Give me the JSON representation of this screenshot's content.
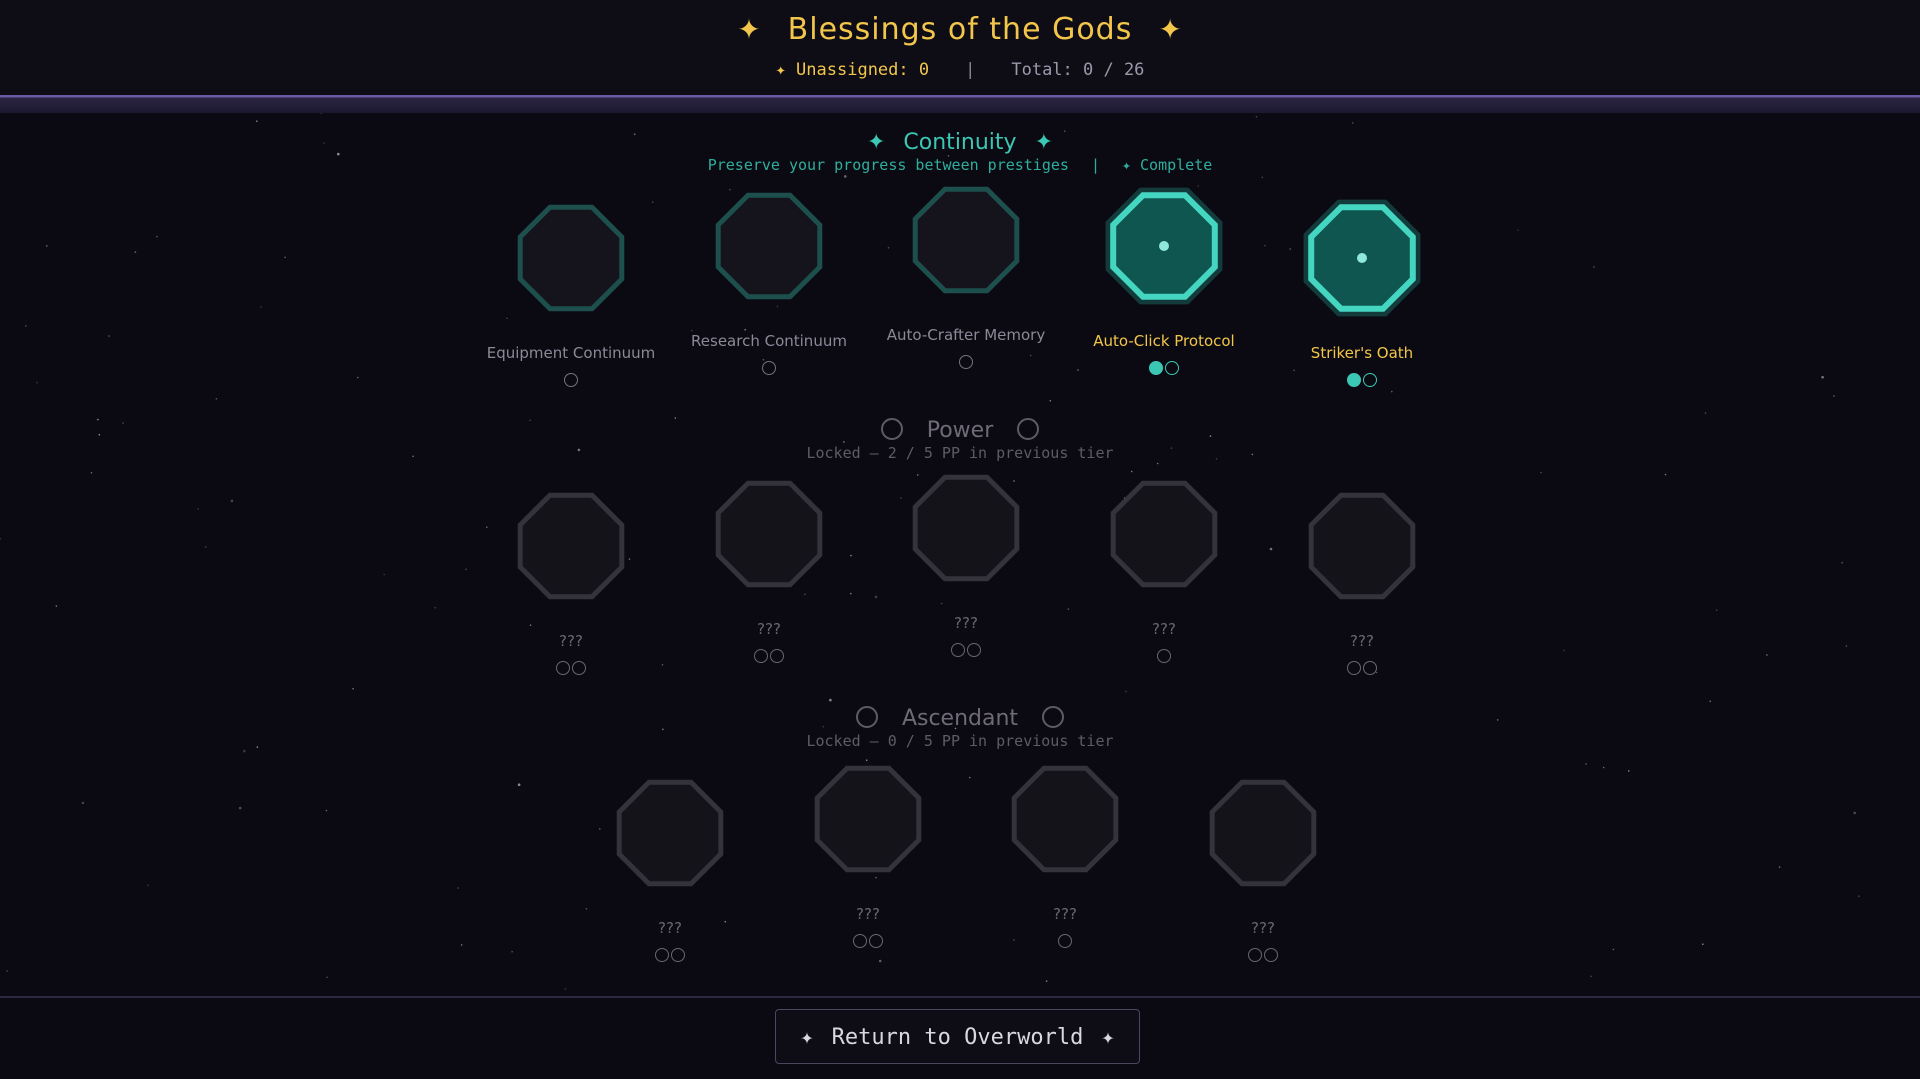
{
  "header": {
    "title": "Blessings of the Gods",
    "title_star": "✦",
    "unassigned": "✦ Unassigned: 0",
    "separator": "|",
    "total": "Total: 0 / 26"
  },
  "colors": {
    "gold": "#f2c64a",
    "teal": "#3cc7b4",
    "background": "#0b0a12"
  },
  "tiers": [
    {
      "name": "Continuity",
      "title_star": "✦",
      "subtitle": "Preserve your progress between prestiges",
      "subtitle_sep": "|",
      "status": "✦ Complete",
      "nodes": [
        {
          "label": "Equipment Continuum",
          "ranks": 0,
          "max": 1,
          "state": "available"
        },
        {
          "label": "Research Continuum",
          "ranks": 0,
          "max": 1,
          "state": "available"
        },
        {
          "label": "Auto-Crafter Memory",
          "ranks": 0,
          "max": 1,
          "state": "available"
        },
        {
          "label": "Auto-Click Protocol",
          "ranks": 1,
          "max": 2,
          "state": "active"
        },
        {
          "label": "Striker's Oath",
          "ranks": 1,
          "max": 2,
          "state": "active"
        }
      ]
    },
    {
      "name": "Power",
      "subtitle": "Locked — 2 / 5 PP in previous tier",
      "nodes": [
        {
          "label": "???",
          "ranks": 0,
          "max": 2,
          "state": "locked"
        },
        {
          "label": "???",
          "ranks": 0,
          "max": 2,
          "state": "locked"
        },
        {
          "label": "???",
          "ranks": 0,
          "max": 2,
          "state": "locked"
        },
        {
          "label": "???",
          "ranks": 0,
          "max": 1,
          "state": "locked"
        },
        {
          "label": "???",
          "ranks": 0,
          "max": 2,
          "state": "locked"
        }
      ]
    },
    {
      "name": "Ascendant",
      "subtitle": "Locked — 0 / 5 PP in previous tier",
      "nodes": [
        {
          "label": "???",
          "ranks": 0,
          "max": 2,
          "state": "locked"
        },
        {
          "label": "???",
          "ranks": 0,
          "max": 2,
          "state": "locked"
        },
        {
          "label": "???",
          "ranks": 0,
          "max": 1,
          "state": "locked"
        },
        {
          "label": "???",
          "ranks": 0,
          "max": 2,
          "state": "locked"
        }
      ]
    }
  ],
  "footer": {
    "button_star": "✦",
    "return_label": "Return to Overworld"
  }
}
